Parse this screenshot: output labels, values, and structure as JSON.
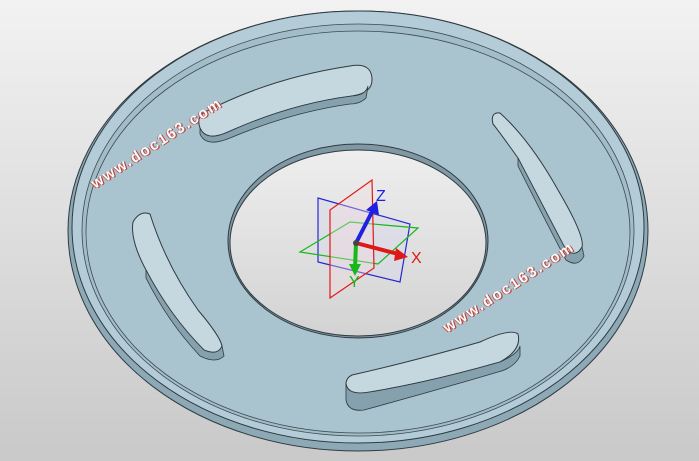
{
  "viewport": {
    "background_top": "#f2f2f2",
    "background_bottom": "#c9c9c9",
    "part_color": "#a9c3cf",
    "part_edge_color": "#2f3a40"
  },
  "triad": {
    "x_label": "X",
    "y_label": "Y",
    "z_label": "Z",
    "x_color": "#e01818",
    "y_color": "#18b818",
    "z_color": "#2020e0"
  },
  "watermarks": [
    {
      "text": "www.doc163.com"
    },
    {
      "text": "www.doc163.com"
    }
  ]
}
